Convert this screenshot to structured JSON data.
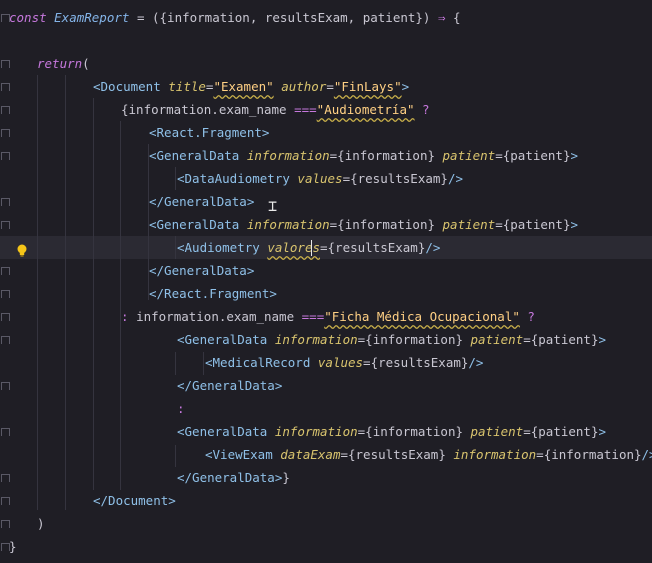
{
  "editor": {
    "lines": [
      {
        "indent": 0,
        "fold": true,
        "tokens": [
          [
            "kw",
            "const "
          ],
          [
            "fn",
            "ExamReport"
          ],
          [
            "pun",
            " = ({information, resultsExam, patient}) "
          ],
          [
            "op",
            "⇒"
          ],
          [
            "pun",
            " {"
          ]
        ]
      },
      {
        "indent": 0,
        "tokens": []
      },
      {
        "indent": 1,
        "fold": true,
        "tokens": [
          [
            "kw",
            "return"
          ],
          [
            "pun",
            "("
          ]
        ]
      },
      {
        "indent": 3,
        "fold": true,
        "tokens": [
          [
            "tag",
            "<Document "
          ],
          [
            "attr",
            "title"
          ],
          [
            "pun",
            "="
          ],
          [
            "str",
            "\"Examen\""
          ],
          [
            "pun",
            " "
          ],
          [
            "attr",
            "author"
          ],
          [
            "pun",
            "="
          ],
          [
            "str",
            "\"FinLays\""
          ],
          [
            "tag",
            ">"
          ]
        ]
      },
      {
        "indent": 4,
        "fold": true,
        "tokens": [
          [
            "pun",
            "{information.exam_name "
          ],
          [
            "op",
            "==="
          ],
          [
            "str",
            "\"Audiometría\""
          ],
          [
            "op",
            " ?"
          ]
        ]
      },
      {
        "indent": 5,
        "fold": true,
        "tokens": [
          [
            "tag",
            "<React.Fragment>"
          ]
        ]
      },
      {
        "indent": 5,
        "fold": true,
        "tokens": [
          [
            "tag",
            "<GeneralData "
          ],
          [
            "attr",
            "information"
          ],
          [
            "pun",
            "={information} "
          ],
          [
            "attr",
            "patient"
          ],
          [
            "pun",
            "={patient}"
          ],
          [
            "tag",
            ">"
          ]
        ]
      },
      {
        "indent": 6,
        "tokens": [
          [
            "tag",
            "<DataAudiometry "
          ],
          [
            "attr",
            "values"
          ],
          [
            "pun",
            "={resultsExam}"
          ],
          [
            "tag",
            "/>"
          ]
        ]
      },
      {
        "indent": 5,
        "fold": true,
        "tokens": [
          [
            "tag",
            "</GeneralData>"
          ]
        ]
      },
      {
        "indent": 5,
        "fold": true,
        "tokens": [
          [
            "tag",
            "<GeneralData "
          ],
          [
            "attr",
            "information"
          ],
          [
            "pun",
            "={information} "
          ],
          [
            "attr",
            "patient"
          ],
          [
            "pun",
            "={patient}"
          ],
          [
            "tag",
            ">"
          ]
        ]
      },
      {
        "indent": 6,
        "active": true,
        "bulb": true,
        "tokens": [
          [
            "tag",
            "<Audiometry "
          ],
          [
            "attr",
            "valores"
          ],
          [
            "pun",
            "={resultsExam}"
          ],
          [
            "tag",
            "/>"
          ]
        ]
      },
      {
        "indent": 5,
        "fold": true,
        "tokens": [
          [
            "tag",
            "</GeneralData>"
          ]
        ]
      },
      {
        "indent": 5,
        "fold": true,
        "tokens": [
          [
            "tag",
            "</React.Fragment>"
          ]
        ]
      },
      {
        "indent": 4,
        "fold": true,
        "tokens": [
          [
            "op",
            ": "
          ],
          [
            "pun",
            "information.exam_name "
          ],
          [
            "op",
            "==="
          ],
          [
            "str",
            "\"Ficha Médica Ocupacional\""
          ],
          [
            "op",
            " ?"
          ]
        ]
      },
      {
        "indent": 6,
        "fold": true,
        "tokens": [
          [
            "tag",
            "<GeneralData "
          ],
          [
            "attr",
            "information"
          ],
          [
            "pun",
            "={information} "
          ],
          [
            "attr",
            "patient"
          ],
          [
            "pun",
            "={patient}"
          ],
          [
            "tag",
            ">"
          ]
        ]
      },
      {
        "indent": 7,
        "tokens": [
          [
            "tag",
            "<MedicalRecord "
          ],
          [
            "attr",
            "values"
          ],
          [
            "pun",
            "={resultsExam}"
          ],
          [
            "tag",
            "/>"
          ]
        ]
      },
      {
        "indent": 6,
        "fold": true,
        "tokens": [
          [
            "tag",
            "</GeneralData>"
          ]
        ]
      },
      {
        "indent": 6,
        "tokens": [
          [
            "op",
            ":"
          ]
        ]
      },
      {
        "indent": 6,
        "fold": true,
        "tokens": [
          [
            "tag",
            "<GeneralData "
          ],
          [
            "attr",
            "information"
          ],
          [
            "pun",
            "={information} "
          ],
          [
            "attr",
            "patient"
          ],
          [
            "pun",
            "={patient}"
          ],
          [
            "tag",
            ">"
          ]
        ]
      },
      {
        "indent": 7,
        "tokens": [
          [
            "tag",
            "<ViewExam "
          ],
          [
            "attr",
            "dataExam"
          ],
          [
            "pun",
            "={resultsExam} "
          ],
          [
            "attr",
            "information"
          ],
          [
            "pun",
            "={information}"
          ],
          [
            "tag",
            "/>"
          ]
        ]
      },
      {
        "indent": 6,
        "fold": true,
        "tokens": [
          [
            "tag",
            "</GeneralData>"
          ],
          [
            "pun",
            "}"
          ]
        ]
      },
      {
        "indent": 3,
        "fold": true,
        "tokens": [
          [
            "tag",
            "</Document>"
          ]
        ]
      },
      {
        "indent": 1,
        "fold": true,
        "tokens": [
          [
            "pun",
            ")"
          ]
        ]
      },
      {
        "indent": 0,
        "fold": true,
        "tokens": [
          [
            "pun",
            "}"
          ]
        ]
      }
    ]
  },
  "colors": {
    "background": "#1f1e25",
    "active_line": "#2b2a33",
    "bulb": "#f5c518"
  },
  "icons": {
    "bulb": "lightbulb-icon",
    "fold": "fold-chevron-icon"
  }
}
